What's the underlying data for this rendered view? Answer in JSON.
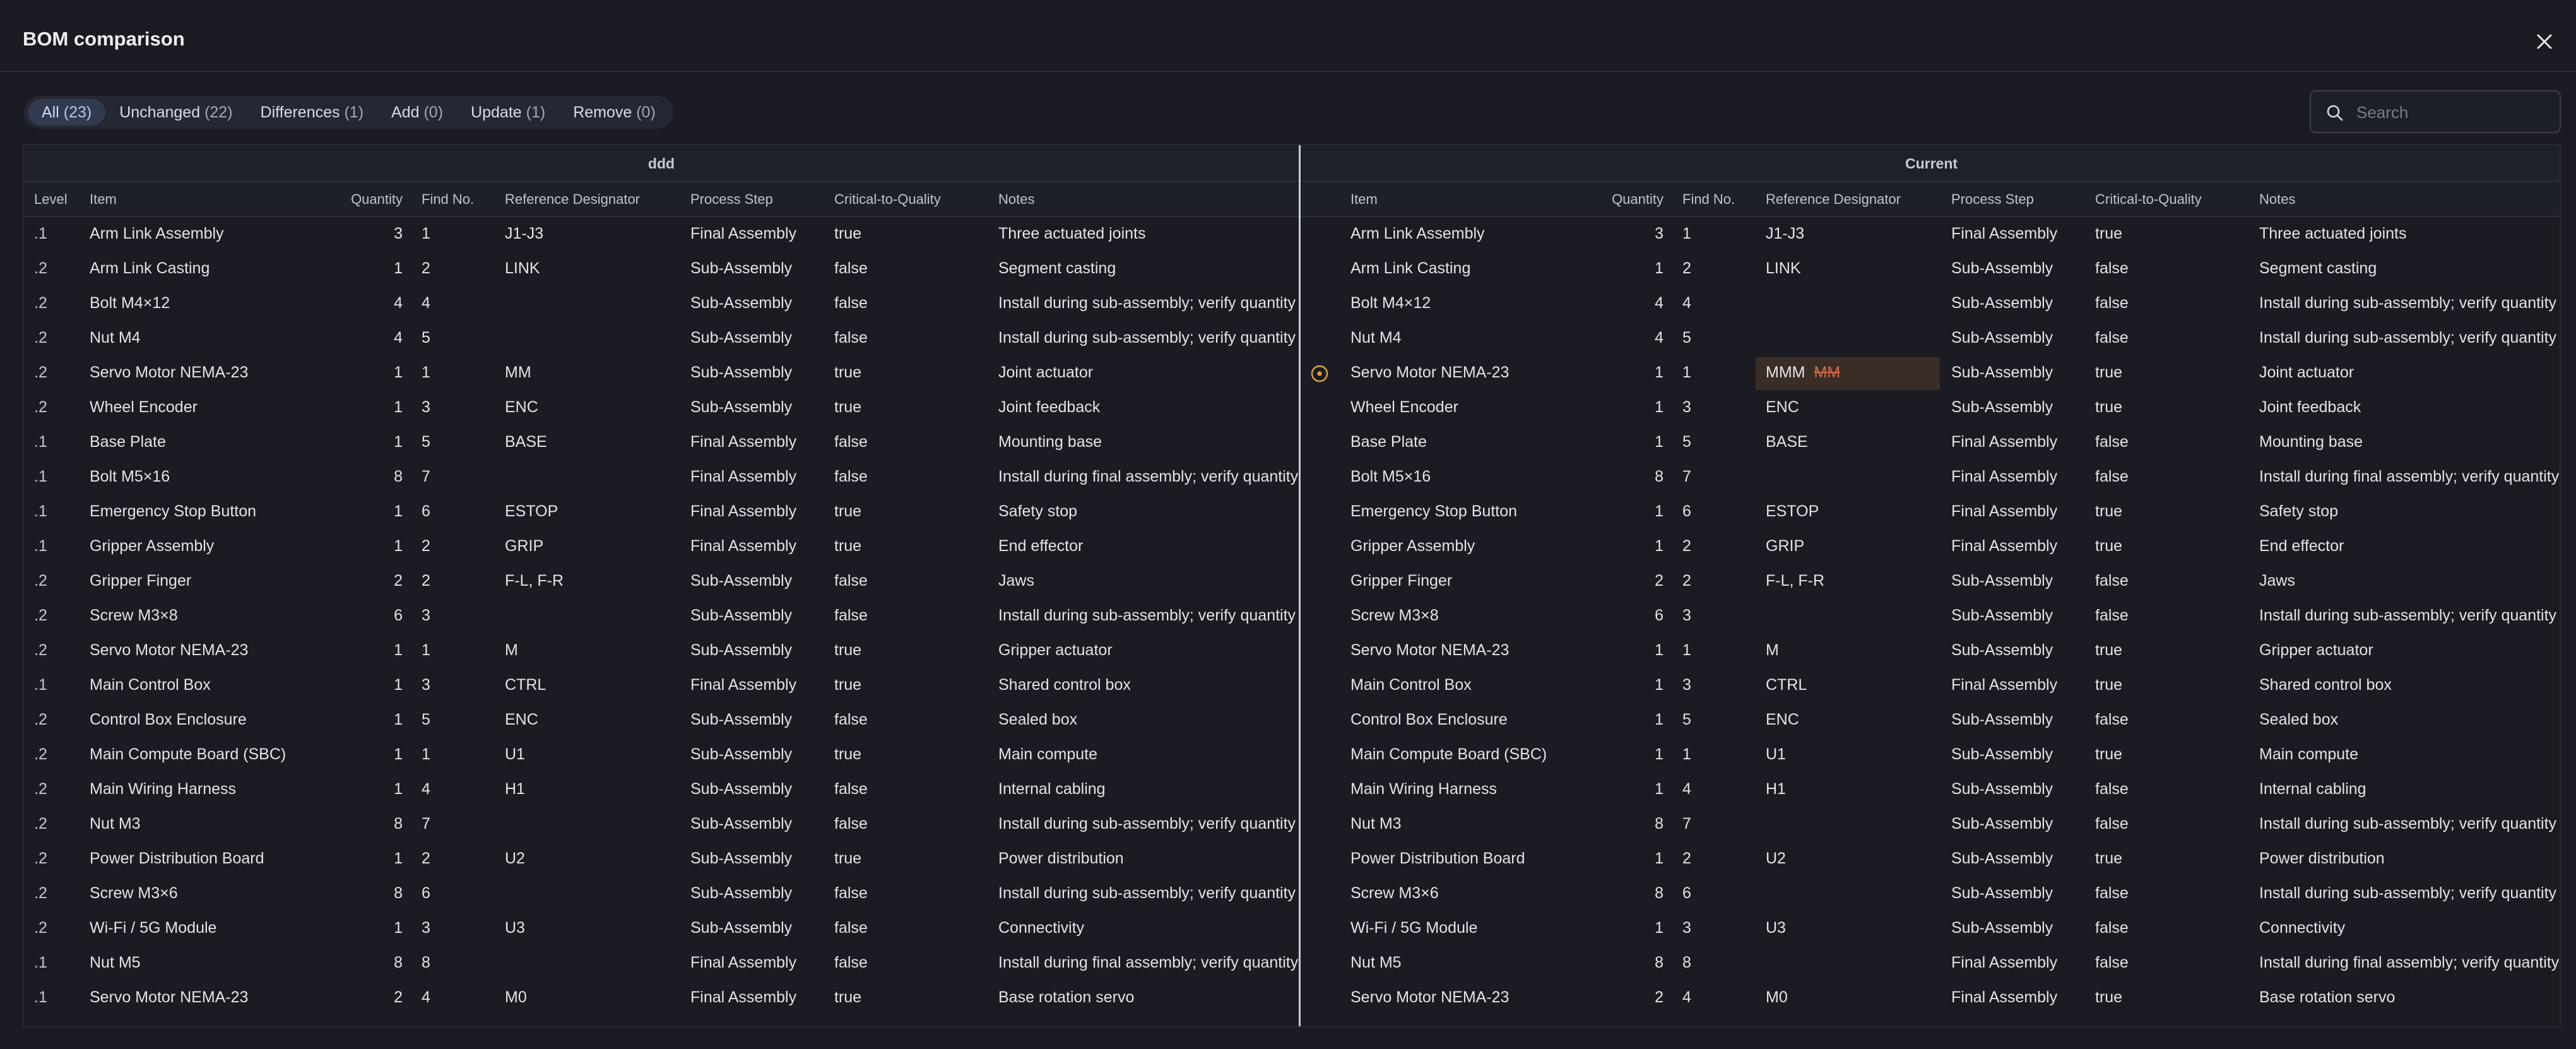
{
  "dialog": {
    "title": "BOM comparison",
    "close_icon": "close-icon"
  },
  "tabs": [
    {
      "label": "All",
      "count": "(23)",
      "active": true
    },
    {
      "label": "Unchanged",
      "count": "(22)",
      "active": false
    },
    {
      "label": "Differences",
      "count": "(1)",
      "active": false
    },
    {
      "label": "Add",
      "count": "(0)",
      "active": false
    },
    {
      "label": "Update",
      "count": "(1)",
      "active": false
    },
    {
      "label": "Remove",
      "count": "(0)",
      "active": false
    }
  ],
  "search": {
    "placeholder": "Search",
    "value": "",
    "icon": "search-icon"
  },
  "table": {
    "left_group": "ddd",
    "right_group": "Current",
    "columns": {
      "level": "Level",
      "item": "Item",
      "quantity": "Quantity",
      "find_no": "Find No.",
      "ref": "Reference Designator",
      "step": "Process Step",
      "ctq": "Critical-to-Quality",
      "notes": "Notes"
    },
    "left_rows": [
      {
        "level": ".1",
        "item": "Arm Link Assembly",
        "qty": "3",
        "find": "1",
        "ref": "J1-J3",
        "step": "Final Assembly",
        "ctq": "true",
        "notes": "Three actuated joints"
      },
      {
        "level": ".2",
        "item": "Arm Link Casting",
        "qty": "1",
        "find": "2",
        "ref": "LINK",
        "step": "Sub-Assembly",
        "ctq": "false",
        "notes": "Segment casting"
      },
      {
        "level": ".2",
        "item": "Bolt M4×12",
        "qty": "4",
        "find": "4",
        "ref": "",
        "step": "Sub-Assembly",
        "ctq": "false",
        "notes": "Install during sub-assembly; verify quantity"
      },
      {
        "level": ".2",
        "item": "Nut M4",
        "qty": "4",
        "find": "5",
        "ref": "",
        "step": "Sub-Assembly",
        "ctq": "false",
        "notes": "Install during sub-assembly; verify quantity"
      },
      {
        "level": ".2",
        "item": "Servo Motor NEMA-23",
        "qty": "1",
        "find": "1",
        "ref": "MM",
        "step": "Sub-Assembly",
        "ctq": "true",
        "notes": "Joint actuator"
      },
      {
        "level": ".2",
        "item": "Wheel Encoder",
        "qty": "1",
        "find": "3",
        "ref": "ENC",
        "step": "Sub-Assembly",
        "ctq": "true",
        "notes": "Joint feedback"
      },
      {
        "level": ".1",
        "item": "Base Plate",
        "qty": "1",
        "find": "5",
        "ref": "BASE",
        "step": "Final Assembly",
        "ctq": "false",
        "notes": "Mounting base"
      },
      {
        "level": ".1",
        "item": "Bolt M5×16",
        "qty": "8",
        "find": "7",
        "ref": "",
        "step": "Final Assembly",
        "ctq": "false",
        "notes": "Install during final assembly; verify quantity"
      },
      {
        "level": ".1",
        "item": "Emergency Stop Button",
        "qty": "1",
        "find": "6",
        "ref": "ESTOP",
        "step": "Final Assembly",
        "ctq": "true",
        "notes": "Safety stop"
      },
      {
        "level": ".1",
        "item": "Gripper Assembly",
        "qty": "1",
        "find": "2",
        "ref": "GRIP",
        "step": "Final Assembly",
        "ctq": "true",
        "notes": "End effector"
      },
      {
        "level": ".2",
        "item": "Gripper Finger",
        "qty": "2",
        "find": "2",
        "ref": "F-L, F-R",
        "step": "Sub-Assembly",
        "ctq": "false",
        "notes": "Jaws"
      },
      {
        "level": ".2",
        "item": "Screw M3×8",
        "qty": "6",
        "find": "3",
        "ref": "",
        "step": "Sub-Assembly",
        "ctq": "false",
        "notes": "Install during sub-assembly; verify quantity"
      },
      {
        "level": ".2",
        "item": "Servo Motor NEMA-23",
        "qty": "1",
        "find": "1",
        "ref": "M",
        "step": "Sub-Assembly",
        "ctq": "true",
        "notes": "Gripper actuator"
      },
      {
        "level": ".1",
        "item": "Main Control Box",
        "qty": "1",
        "find": "3",
        "ref": "CTRL",
        "step": "Final Assembly",
        "ctq": "true",
        "notes": "Shared control box"
      },
      {
        "level": ".2",
        "item": "Control Box Enclosure",
        "qty": "1",
        "find": "5",
        "ref": "ENC",
        "step": "Sub-Assembly",
        "ctq": "false",
        "notes": "Sealed box"
      },
      {
        "level": ".2",
        "item": "Main Compute Board (SBC)",
        "qty": "1",
        "find": "1",
        "ref": "U1",
        "step": "Sub-Assembly",
        "ctq": "true",
        "notes": "Main compute"
      },
      {
        "level": ".2",
        "item": "Main Wiring Harness",
        "qty": "1",
        "find": "4",
        "ref": "H1",
        "step": "Sub-Assembly",
        "ctq": "false",
        "notes": "Internal cabling"
      },
      {
        "level": ".2",
        "item": "Nut M3",
        "qty": "8",
        "find": "7",
        "ref": "",
        "step": "Sub-Assembly",
        "ctq": "false",
        "notes": "Install during sub-assembly; verify quantity"
      },
      {
        "level": ".2",
        "item": "Power Distribution Board",
        "qty": "1",
        "find": "2",
        "ref": "U2",
        "step": "Sub-Assembly",
        "ctq": "true",
        "notes": "Power distribution"
      },
      {
        "level": ".2",
        "item": "Screw M3×6",
        "qty": "8",
        "find": "6",
        "ref": "",
        "step": "Sub-Assembly",
        "ctq": "false",
        "notes": "Install during sub-assembly; verify quantity"
      },
      {
        "level": ".2",
        "item": "Wi-Fi / 5G Module",
        "qty": "1",
        "find": "3",
        "ref": "U3",
        "step": "Sub-Assembly",
        "ctq": "false",
        "notes": "Connectivity"
      },
      {
        "level": ".1",
        "item": "Nut M5",
        "qty": "8",
        "find": "8",
        "ref": "",
        "step": "Final Assembly",
        "ctq": "false",
        "notes": "Install during final assembly; verify quantity"
      },
      {
        "level": ".1",
        "item": "Servo Motor NEMA-23",
        "qty": "2",
        "find": "4",
        "ref": "M0",
        "step": "Final Assembly",
        "ctq": "true",
        "notes": "Base rotation servo"
      }
    ],
    "right_rows": [
      {
        "item": "Arm Link Assembly",
        "qty": "3",
        "find": "1",
        "ref": "J1-J3",
        "step": "Final Assembly",
        "ctq": "true",
        "notes": "Three actuated joints"
      },
      {
        "item": "Arm Link Casting",
        "qty": "1",
        "find": "2",
        "ref": "LINK",
        "step": "Sub-Assembly",
        "ctq": "false",
        "notes": "Segment casting"
      },
      {
        "item": "Bolt M4×12",
        "qty": "4",
        "find": "4",
        "ref": "",
        "step": "Sub-Assembly",
        "ctq": "false",
        "notes": "Install during sub-assembly; verify quantity"
      },
      {
        "item": "Nut M4",
        "qty": "4",
        "find": "5",
        "ref": "",
        "step": "Sub-Assembly",
        "ctq": "false",
        "notes": "Install during sub-assembly; verify quantity"
      },
      {
        "item": "Servo Motor NEMA-23",
        "qty": "1",
        "find": "1",
        "ref": "MMM",
        "ref_old": "MM",
        "changed": true,
        "step": "Sub-Assembly",
        "ctq": "true",
        "notes": "Joint actuator"
      },
      {
        "item": "Wheel Encoder",
        "qty": "1",
        "find": "3",
        "ref": "ENC",
        "step": "Sub-Assembly",
        "ctq": "true",
        "notes": "Joint feedback"
      },
      {
        "item": "Base Plate",
        "qty": "1",
        "find": "5",
        "ref": "BASE",
        "step": "Final Assembly",
        "ctq": "false",
        "notes": "Mounting base"
      },
      {
        "item": "Bolt M5×16",
        "qty": "8",
        "find": "7",
        "ref": "",
        "step": "Final Assembly",
        "ctq": "false",
        "notes": "Install during final assembly; verify quantity"
      },
      {
        "item": "Emergency Stop Button",
        "qty": "1",
        "find": "6",
        "ref": "ESTOP",
        "step": "Final Assembly",
        "ctq": "true",
        "notes": "Safety stop"
      },
      {
        "item": "Gripper Assembly",
        "qty": "1",
        "find": "2",
        "ref": "GRIP",
        "step": "Final Assembly",
        "ctq": "true",
        "notes": "End effector"
      },
      {
        "item": "Gripper Finger",
        "qty": "2",
        "find": "2",
        "ref": "F-L, F-R",
        "step": "Sub-Assembly",
        "ctq": "false",
        "notes": "Jaws"
      },
      {
        "item": "Screw M3×8",
        "qty": "6",
        "find": "3",
        "ref": "",
        "step": "Sub-Assembly",
        "ctq": "false",
        "notes": "Install during sub-assembly; verify quantity"
      },
      {
        "item": "Servo Motor NEMA-23",
        "qty": "1",
        "find": "1",
        "ref": "M",
        "step": "Sub-Assembly",
        "ctq": "true",
        "notes": "Gripper actuator"
      },
      {
        "item": "Main Control Box",
        "qty": "1",
        "find": "3",
        "ref": "CTRL",
        "step": "Final Assembly",
        "ctq": "true",
        "notes": "Shared control box"
      },
      {
        "item": "Control Box Enclosure",
        "qty": "1",
        "find": "5",
        "ref": "ENC",
        "step": "Sub-Assembly",
        "ctq": "false",
        "notes": "Sealed box"
      },
      {
        "item": "Main Compute Board (SBC)",
        "qty": "1",
        "find": "1",
        "ref": "U1",
        "step": "Sub-Assembly",
        "ctq": "true",
        "notes": "Main compute"
      },
      {
        "item": "Main Wiring Harness",
        "qty": "1",
        "find": "4",
        "ref": "H1",
        "step": "Sub-Assembly",
        "ctq": "false",
        "notes": "Internal cabling"
      },
      {
        "item": "Nut M3",
        "qty": "8",
        "find": "7",
        "ref": "",
        "step": "Sub-Assembly",
        "ctq": "false",
        "notes": "Install during sub-assembly; verify quantity"
      },
      {
        "item": "Power Distribution Board",
        "qty": "1",
        "find": "2",
        "ref": "U2",
        "step": "Sub-Assembly",
        "ctq": "true",
        "notes": "Power distribution"
      },
      {
        "item": "Screw M3×6",
        "qty": "8",
        "find": "6",
        "ref": "",
        "step": "Sub-Assembly",
        "ctq": "false",
        "notes": "Install during sub-assembly; verify quantity"
      },
      {
        "item": "Wi-Fi / 5G Module",
        "qty": "1",
        "find": "3",
        "ref": "U3",
        "step": "Sub-Assembly",
        "ctq": "false",
        "notes": "Connectivity"
      },
      {
        "item": "Nut M5",
        "qty": "8",
        "find": "8",
        "ref": "",
        "step": "Final Assembly",
        "ctq": "false",
        "notes": "Install during final assembly; verify quantity"
      },
      {
        "item": "Servo Motor NEMA-23",
        "qty": "2",
        "find": "4",
        "ref": "M0",
        "step": "Final Assembly",
        "ctq": "true",
        "notes": "Base rotation servo"
      }
    ]
  },
  "colors": {
    "background": "#1b1c23",
    "active_tab": "#323a50",
    "change_highlight": "#3a2c26",
    "removed_text": "#d26a4e",
    "change_marker": "#e0a23c"
  }
}
